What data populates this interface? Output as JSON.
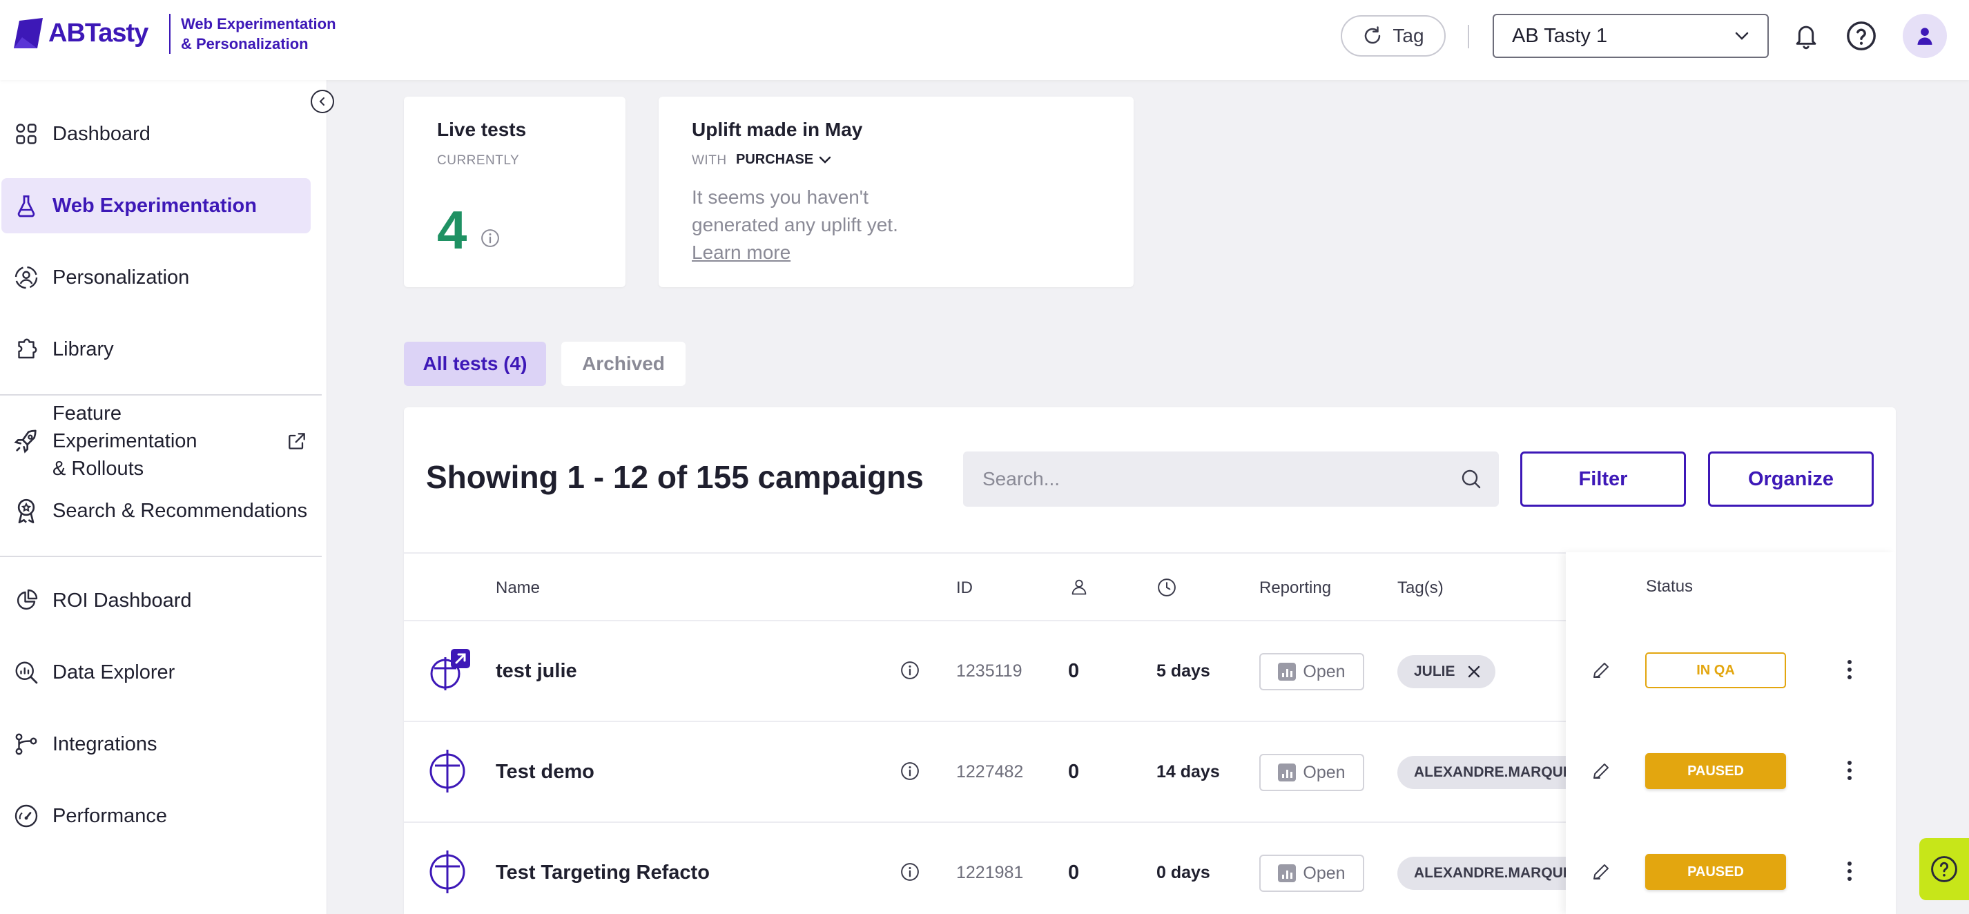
{
  "brand": {
    "logo_text": "ABTasty",
    "subtitle_line1": "Web Experimentation",
    "subtitle_line2": "& Personalization",
    "color": "#3d18b7"
  },
  "header": {
    "tag_button_label": "Tag",
    "account_selected": "AB Tasty 1",
    "icons": [
      "refresh-icon",
      "bell-icon",
      "help-icon",
      "user-icon"
    ]
  },
  "sidebar": {
    "items": [
      {
        "label": "Dashboard",
        "icon": "dashboard-icon"
      },
      {
        "label": "Web Experimentation",
        "icon": "flask-icon",
        "active": true
      },
      {
        "label": "Personalization",
        "icon": "personalization-icon"
      },
      {
        "label": "Library",
        "icon": "puzzle-icon"
      },
      {
        "label": "Feature Experimentation & Rollouts",
        "line1": "Feature Experimentation",
        "line2": "& Rollouts",
        "icon": "rocket-icon",
        "external": true
      },
      {
        "label": "Search & Recommendations",
        "icon": "award-icon"
      },
      {
        "label": "ROI Dashboard",
        "icon": "pie-chart-icon"
      },
      {
        "label": "Data Explorer",
        "icon": "chart-search-icon"
      },
      {
        "label": "Integrations",
        "icon": "integrations-icon"
      },
      {
        "label": "Performance",
        "icon": "gauge-icon"
      }
    ]
  },
  "cards": {
    "live_tests": {
      "title": "Live tests",
      "subtitle": "CURRENTLY",
      "value": "4"
    },
    "uplift": {
      "title": "Uplift made in May",
      "with_label": "WITH",
      "goal": "PURCHASE",
      "message_line1": "It seems you haven't",
      "message_line2": "generated any uplift yet.",
      "learn_more": "Learn more"
    }
  },
  "tabs": [
    {
      "label": "All tests (4)",
      "active": true
    },
    {
      "label": "Archived",
      "active": false
    }
  ],
  "campaigns": {
    "showing_text": "Showing 1 - 12 of 155 campaigns",
    "search_placeholder": "Search...",
    "filter_label": "Filter",
    "organize_label": "Organize",
    "columns": {
      "name": "Name",
      "id": "ID",
      "reporting": "Reporting",
      "tags": "Tag(s)",
      "status": "Status"
    },
    "rows": [
      {
        "name": "test julie",
        "id": "1235119",
        "visitors": "0",
        "duration": "5 days",
        "reporting": "Open",
        "tag": "JULIE",
        "tag_removable": true,
        "status": "IN QA",
        "status_color": "#e3a60f"
      },
      {
        "name": "Test demo",
        "id": "1227482",
        "visitors": "0",
        "duration": "14 days",
        "reporting": "Open",
        "tag": "ALEXANDRE.MARQUIS",
        "tag_removable": false,
        "status": "PAUSED",
        "status_color": "#e3a60f"
      },
      {
        "name": "Test Targeting Refacto",
        "id": "1221981",
        "visitors": "0",
        "duration": "0 days",
        "reporting": "Open",
        "tag": "ALEXANDRE.MARQUIS",
        "tag_removable": false,
        "status": "PAUSED",
        "status_color": "#e3a60f"
      }
    ]
  },
  "colors": {
    "accent": "#3d18b7",
    "live_number": "#1f9163",
    "status_warn": "#e3a60f",
    "help_fab": "#c7e619"
  }
}
